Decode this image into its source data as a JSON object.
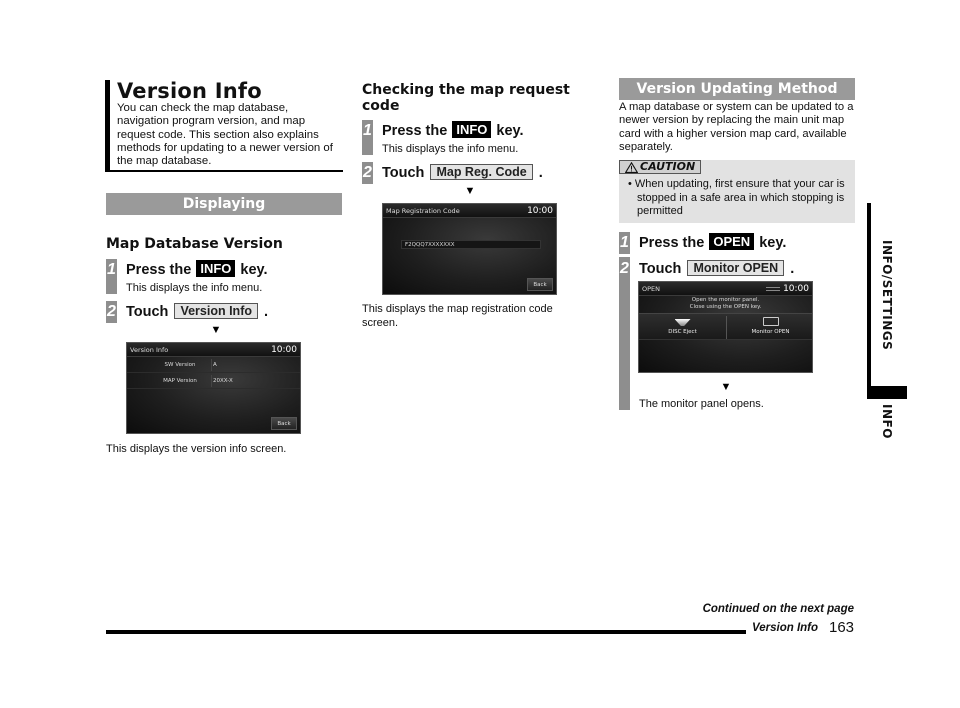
{
  "column1": {
    "title": "Version Info",
    "intro": "You can check the map database, navigation program version, and map request code. This section also explains methods for updating to a newer version of the map database.",
    "section_bar": "Displaying",
    "subheading": "Map Database Version",
    "steps": [
      {
        "num": "1",
        "pre": "Press the",
        "key": "INFO",
        "post": "key.",
        "desc": "This displays the info menu."
      },
      {
        "num": "2",
        "pre": "Touch",
        "button": "Version Info",
        "post": "."
      }
    ],
    "arrow": "▼",
    "screen": {
      "title": "Version Info",
      "clock": "10:00",
      "rows": [
        {
          "label": "SW Version",
          "value": "A"
        },
        {
          "label": "MAP Version",
          "value": "20XX-X"
        }
      ],
      "back": "Back"
    },
    "caption": "This displays the version info screen."
  },
  "column2": {
    "heading": "Checking the map request code",
    "steps": [
      {
        "num": "1",
        "pre": "Press the",
        "key": "INFO",
        "post": "key.",
        "desc": "This displays the info menu."
      },
      {
        "num": "2",
        "pre": "Touch",
        "button": "Map Reg. Code",
        "post": "."
      }
    ],
    "arrow": "▼",
    "screen": {
      "title": "Map Registration Code",
      "clock": "10:00",
      "code": "F2QQQ7XXXXXXX",
      "back": "Back"
    },
    "caption": "This displays the map registration code screen."
  },
  "column3": {
    "section_bar": "Version Updating Method",
    "intro": "A map database or system can be updated to a newer version by replacing the main unit map card with a higher version map card, available separately.",
    "caution": {
      "icon": "warning-triangle",
      "label": "CAUTION",
      "text": "• When updating, first ensure that your car is stopped in a safe area in which stopping is permitted"
    },
    "steps": [
      {
        "num": "1",
        "pre": "Press the",
        "key": "OPEN",
        "post": "key."
      },
      {
        "num": "2",
        "pre": "Touch",
        "button": "Monitor OPEN",
        "post": "."
      }
    ],
    "screen": {
      "title": "OPEN",
      "clock": "10:00",
      "message_line1": "Open the monitor panel.",
      "message_line2": "Close using the OPEN key.",
      "buttons": [
        "DISC Eject",
        "Monitor OPEN"
      ]
    },
    "arrow": "▼",
    "caption": "The monitor panel opens."
  },
  "side_tab": {
    "chapter": "INFO/SETTINGS",
    "section": "INFO"
  },
  "footer": {
    "continued": "Continued on the next page",
    "section": "Version Info",
    "page": "163"
  }
}
